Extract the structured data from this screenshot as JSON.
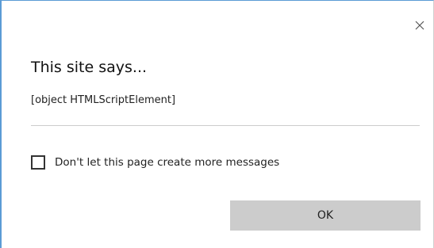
{
  "dialog": {
    "title": "This site says...",
    "message": "[object HTMLScriptElement]",
    "checkbox_label": "Don't let this page create more messages",
    "checkbox_checked": false,
    "ok_label": "OK",
    "close_icon": "close-icon",
    "colors": {
      "accent_border": "#5b9bd5",
      "button_bg": "#cccccc",
      "divider": "#cccccc"
    }
  }
}
